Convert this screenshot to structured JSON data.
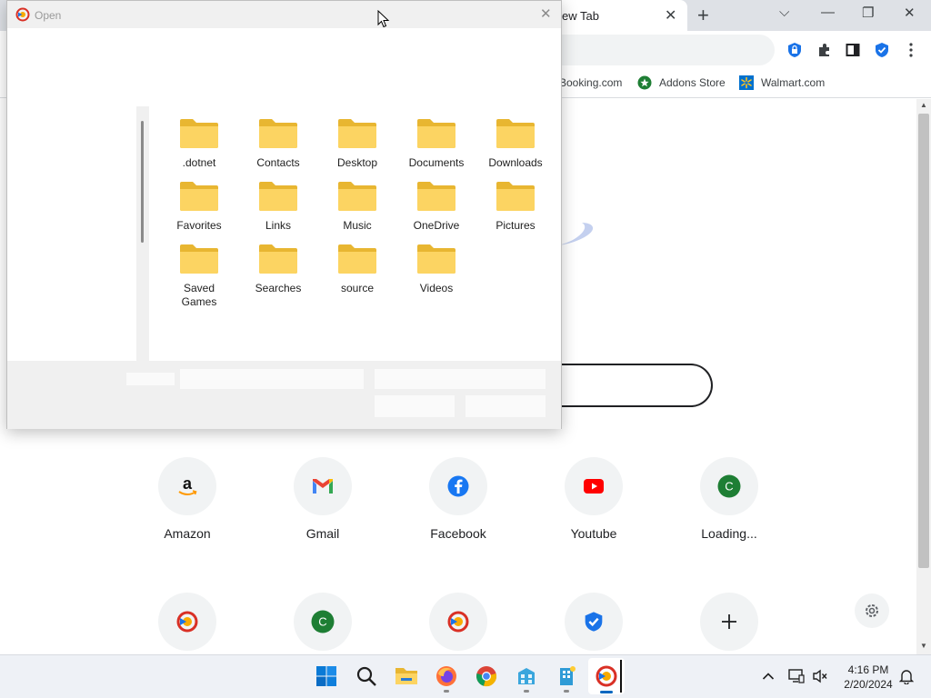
{
  "browser": {
    "tab_title": "ew Tab",
    "tab_close": "✕",
    "new_tab": "+",
    "window": {
      "chevron": "⌵",
      "minimize": "—",
      "restore": "❐",
      "close": "✕"
    },
    "bookmarks": [
      {
        "label": "Booking.com",
        "icon": "none"
      },
      {
        "label": "Addons Store",
        "icon": "addons-store-icon"
      },
      {
        "label": "Walmart.com",
        "icon": "walmart-icon"
      }
    ],
    "shortcuts_row1": [
      {
        "label": "Amazon",
        "icon": "amazon-icon",
        "glyph": "a"
      },
      {
        "label": "Gmail",
        "icon": "gmail-icon",
        "glyph": "M"
      },
      {
        "label": "Facebook",
        "icon": "facebook-icon",
        "glyph": "f"
      },
      {
        "label": "Youtube",
        "icon": "youtube-icon",
        "glyph": "▶"
      },
      {
        "label": "Loading...",
        "icon": "letter-c-icon",
        "glyph": "C"
      }
    ],
    "shortcuts_row2": [
      {
        "icon": "app-logo-icon",
        "glyph": ""
      },
      {
        "icon": "letter-c-icon",
        "glyph": "C"
      },
      {
        "icon": "app-logo-icon",
        "glyph": ""
      },
      {
        "icon": "shield-check-icon",
        "glyph": ""
      },
      {
        "icon": "add-shortcut-icon",
        "glyph": "+"
      }
    ],
    "colors": {
      "tabstrip": "#dee1e6",
      "accent_blue": "#1a73e8",
      "green_badge": "#1e7e34"
    }
  },
  "dialog": {
    "title": "Open",
    "close": "✕",
    "folders": [
      ".dotnet",
      "Contacts",
      "Desktop",
      "Documents",
      "Downloads",
      "Favorites",
      "Links",
      "Music",
      "OneDrive",
      "Pictures",
      "Saved Games",
      "Searches",
      "source",
      "Videos"
    ]
  },
  "taskbar": {
    "time": "4:16 PM",
    "date": "2/20/2024",
    "apps": [
      "start-icon",
      "search-icon",
      "file-explorer-icon",
      "firefox-icon",
      "chrome-icon",
      "app-building-icon",
      "app-building-2-icon",
      "app-logo-icon"
    ]
  }
}
